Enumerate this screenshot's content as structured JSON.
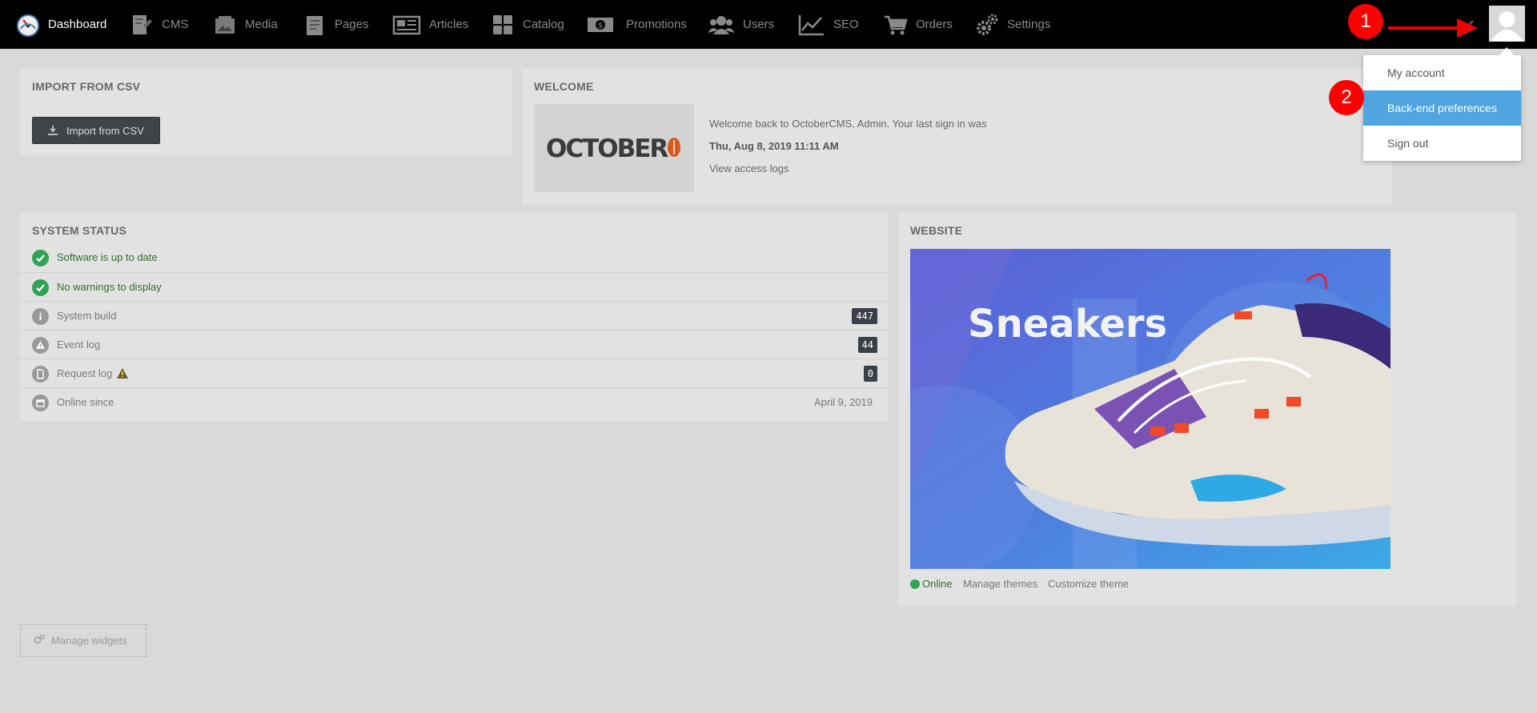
{
  "nav": {
    "items": [
      {
        "label": "Dashboard",
        "icon": "speedometer-icon",
        "active": true
      },
      {
        "label": "CMS",
        "icon": "cms-icon"
      },
      {
        "label": "Media",
        "icon": "media-icon"
      },
      {
        "label": "Pages",
        "icon": "pages-icon"
      },
      {
        "label": "Articles",
        "icon": "newspaper-icon"
      },
      {
        "label": "Catalog",
        "icon": "grid-icon"
      },
      {
        "label": "Promotions",
        "icon": "money-icon"
      },
      {
        "label": "Users",
        "icon": "users-icon"
      },
      {
        "label": "SEO",
        "icon": "chart-line-icon"
      },
      {
        "label": "Orders",
        "icon": "cart-icon"
      },
      {
        "label": "Settings",
        "icon": "gears-icon"
      }
    ]
  },
  "user_menu": {
    "items": [
      "My account",
      "Back-end preferences",
      "Sign out"
    ],
    "highlighted_index": 1
  },
  "annotations": {
    "marker1": "1",
    "marker2": "2"
  },
  "import_widget": {
    "title": "IMPORT FROM CSV",
    "button_label": "Import from CSV"
  },
  "welcome_widget": {
    "title": "WELCOME",
    "logo_text": "OCTOBER",
    "line1": "Welcome back to OctoberCMS, Admin. Your last sign in was",
    "last_signin": "Thu, Aug 8, 2019 11:11 AM",
    "access_logs_link": "View access logs"
  },
  "system_status": {
    "title": "SYSTEM STATUS",
    "rows": [
      {
        "label": "Software is up to date",
        "status": "ok"
      },
      {
        "label": "No warnings to display",
        "status": "ok"
      },
      {
        "label": "System build",
        "value": "447"
      },
      {
        "label": "Event log",
        "value": "44"
      },
      {
        "label": "Request log",
        "value": "0"
      },
      {
        "label": "Online since",
        "value": "April 9, 2019"
      }
    ]
  },
  "website_widget": {
    "title": "WEBSITE",
    "image_text": "Sneakers",
    "status": "Online",
    "manage_themes": "Manage themes",
    "customize_theme": "Customize theme"
  },
  "manage_widgets_label": "Manage widgets",
  "colors": {
    "accent": "#4ea5e0",
    "success": "#31a354",
    "topbar": "#000000",
    "marker": "#ff0000"
  }
}
